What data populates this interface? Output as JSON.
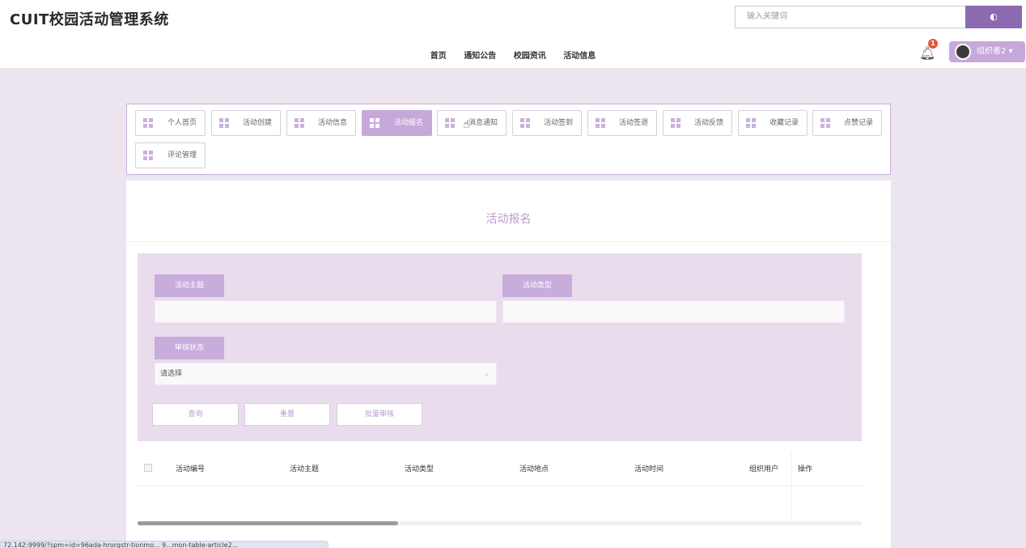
{
  "header": {
    "brand": "CUIT校园活动管理系统",
    "search": {
      "placeholder": "输入关键词"
    },
    "nav": [
      "首页",
      "通知公告",
      "校园资讯",
      "活动信息"
    ],
    "notification_count": "1",
    "user_name": "组织者2"
  },
  "menu": {
    "items": [
      {
        "label": "个人首页",
        "active": false
      },
      {
        "label": "活动创建",
        "active": false
      },
      {
        "label": "活动信息",
        "active": false
      },
      {
        "label": "活动报名",
        "active": true
      },
      {
        "label": "消息通知",
        "active": false
      },
      {
        "label": "活动签到",
        "active": false
      },
      {
        "label": "活动签退",
        "active": false
      },
      {
        "label": "活动反馈",
        "active": false
      },
      {
        "label": "收藏记录",
        "active": false
      },
      {
        "label": "点赞记录",
        "active": false
      },
      {
        "label": "评论管理",
        "active": false
      }
    ]
  },
  "main": {
    "title": "活动报名",
    "form": {
      "theme_label": "活动主题",
      "theme_value": "",
      "type_label": "活动类型",
      "type_value": "",
      "status_label": "审核状态",
      "status_value": "请选择",
      "btn_query": "查询",
      "btn_reset": "重置",
      "btn_batch": "批量审核"
    },
    "table": {
      "columns": [
        "活动编号",
        "活动主题",
        "活动类型",
        "活动地点",
        "活动时间",
        "组织用户",
        "操作"
      ]
    },
    "horizontal_scroll_fraction": 0.36
  },
  "statusbar": {
    "text": "72.142:9999/?spm=id=96ada-hrorgstr-tionmo... 9...mon-table-article2..."
  },
  "colors": {
    "accent": "#8c6ab2",
    "accent_light": "#c7a8db",
    "badge": "#e5553b"
  }
}
